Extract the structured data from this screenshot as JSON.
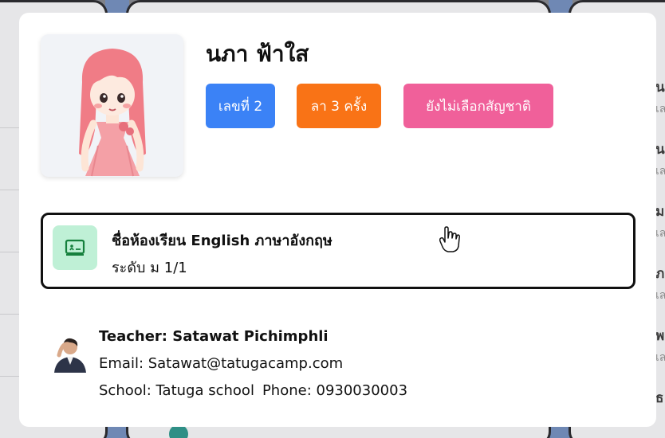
{
  "student": {
    "name": "นภา ฟ้าใส",
    "badges": {
      "number": "เลขที่ 2",
      "leave": "ลา 3 ครั้ง",
      "nationality": "ยังไม่เลือกสัญชาติ"
    },
    "avatar_icon": "girl-avatar-icon"
  },
  "classroom": {
    "name": "ชื่อห้องเรียน English ภาษาอังกฤษ",
    "level": "ระดับ ม 1/1",
    "icon": "classroom-icon"
  },
  "teacher": {
    "name": "Teacher: Satawat Pichimphli",
    "email": "Email: Satawat@tatugacamp.com",
    "school": "School: Tatuga school",
    "phone": "Phone: 0930030003",
    "photo_icon": "teacher-photo-icon"
  },
  "background": {
    "row_initials": [
      "น",
      "น",
      "ม",
      "ภ",
      "พ",
      "ธ"
    ],
    "row_subs": [
      "เล",
      "เล",
      "เล",
      "เล",
      "เล"
    ]
  },
  "colors": {
    "number_badge": "#3b82f6",
    "leave_badge": "#f97316",
    "nationality_badge": "#f0609a",
    "class_icon_bg": "#bff0d6",
    "class_icon_fg": "#15803d"
  }
}
